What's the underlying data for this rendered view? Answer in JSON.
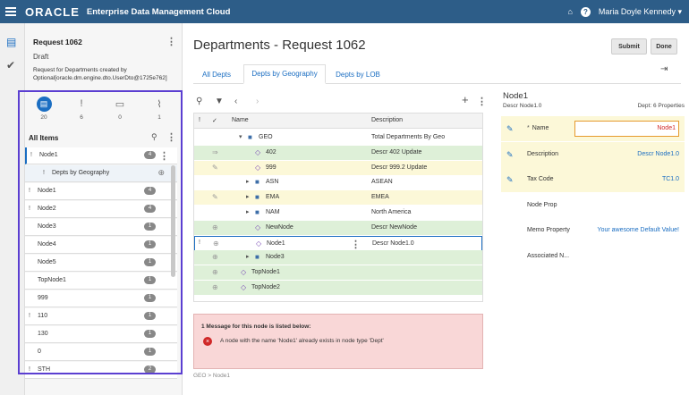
{
  "header": {
    "brand": "ORACLE",
    "app": "Enterprise Data Management Cloud",
    "user": "Maria Doyle Kennedy",
    "user_caret": "▾",
    "home_icon": "home-icon",
    "help_icon": "help-icon",
    "help_glyph": "?"
  },
  "request": {
    "title": "Request 1062",
    "status": "Draft",
    "description": "Request for Departments created by Optional[oracle.dm.engine.dto.UserDto@1725e762]"
  },
  "stats": [
    {
      "icon": "clipboard-icon",
      "count": "20"
    },
    {
      "icon": "exclamation-icon",
      "count": "6"
    },
    {
      "icon": "comment-icon",
      "count": "0"
    },
    {
      "icon": "paperclip-icon",
      "count": "1"
    }
  ],
  "items": {
    "label": "All Items",
    "list": [
      {
        "label": "Node1",
        "badge": "4",
        "flag": "!",
        "selected": true
      },
      {
        "label": "Depts by Geography",
        "badge": "",
        "flag": "!",
        "sub": true
      },
      {
        "label": "Node1",
        "badge": "4",
        "flag": "!"
      },
      {
        "label": "Node2",
        "badge": "4",
        "flag": "!"
      },
      {
        "label": "Node3",
        "badge": "1",
        "flag": ""
      },
      {
        "label": "Node4",
        "badge": "1",
        "flag": ""
      },
      {
        "label": "Node5",
        "badge": "1",
        "flag": ""
      },
      {
        "label": "TopNode1",
        "badge": "1",
        "flag": ""
      },
      {
        "label": "999",
        "badge": "1",
        "flag": ""
      },
      {
        "label": "110",
        "badge": "1",
        "flag": "!"
      },
      {
        "label": "130",
        "badge": "1",
        "flag": ""
      },
      {
        "label": "0",
        "badge": "1",
        "flag": ""
      },
      {
        "label": "STH",
        "badge": "2",
        "flag": "!"
      }
    ]
  },
  "main": {
    "title": "Departments - Request 1062",
    "submit": "Submit",
    "done": "Done",
    "tabs": [
      "All Depts",
      "Depts by Geography",
      "Depts by LOB"
    ],
    "columns": {
      "flag": "!",
      "check": "✓",
      "name": "Name",
      "description": "Description"
    },
    "rows": [
      {
        "name": "GEO",
        "desc": "Total Departments By Geo",
        "status": "",
        "type": "folder",
        "toggle": "▾",
        "level": 1
      },
      {
        "name": "402",
        "desc": "Descr 402 Update",
        "status": "green",
        "type": "diamond",
        "toggle": "",
        "level": 2,
        "action": "⇒"
      },
      {
        "name": "999",
        "desc": "Descr 999.2 Update",
        "status": "yellow",
        "type": "diamond",
        "toggle": "",
        "level": 2,
        "action": "✎"
      },
      {
        "name": "ASN",
        "desc": "ASEAN",
        "status": "",
        "type": "folder",
        "toggle": "▸",
        "level": 2
      },
      {
        "name": "EMA",
        "desc": "EMEA",
        "status": "yellow",
        "type": "folder",
        "toggle": "▸",
        "level": 2,
        "action": "✎"
      },
      {
        "name": "NAM",
        "desc": "North America",
        "status": "",
        "type": "folder",
        "toggle": "▸",
        "level": 2
      },
      {
        "name": "NewNode",
        "desc": "Descr NewNode",
        "status": "green",
        "type": "diamond",
        "toggle": "",
        "level": 2,
        "action": "⊕"
      },
      {
        "name": "Node1",
        "desc": "Descr Node1.0",
        "status": "sel",
        "type": "diamond",
        "toggle": "",
        "level": 2,
        "action": "⊕",
        "flag": "!"
      },
      {
        "name": "Node3",
        "desc": "",
        "status": "green",
        "type": "folder",
        "toggle": "▸",
        "level": 2,
        "action": "⊕"
      },
      {
        "name": "TopNode1",
        "desc": "",
        "status": "green",
        "type": "diamond",
        "toggle": "",
        "level": 0,
        "action": "⊕"
      },
      {
        "name": "TopNode2",
        "desc": "",
        "status": "green",
        "type": "diamond",
        "toggle": "",
        "level": 0,
        "action": "⊕"
      }
    ],
    "message_head": "1 Message for this node is listed below:",
    "message": "A node with the name 'Node1' already exists in node type 'Dept'",
    "breadcrumb": "GEO > Node1"
  },
  "properties": {
    "title": "Node1",
    "subtitle": "Descr Node1.0",
    "meta": "Dept: 6 Properties",
    "rows": [
      {
        "label": "Name",
        "value": "Node1",
        "required": "*",
        "style": "input",
        "edit": true
      },
      {
        "label": "Description",
        "value": "Descr Node1.0",
        "style": "text",
        "edit": true
      },
      {
        "label": "Tax Code",
        "value": "TC1.0",
        "style": "text",
        "edit": true
      },
      {
        "label": "Node Prop",
        "value": "",
        "style": "text",
        "edit": false
      },
      {
        "label": "Memo Property",
        "value": "Your awesome Default Value!",
        "style": "text",
        "edit": false
      },
      {
        "label": "Associated N...",
        "value": "",
        "style": "text",
        "edit": false
      }
    ]
  },
  "colors": {
    "header": "#2d5d88",
    "accent": "#1b6ec2",
    "highlight": "#5b3fd1",
    "added": "#def0d8",
    "modified": "#fcf8d8",
    "error": "#f9d7d7"
  }
}
